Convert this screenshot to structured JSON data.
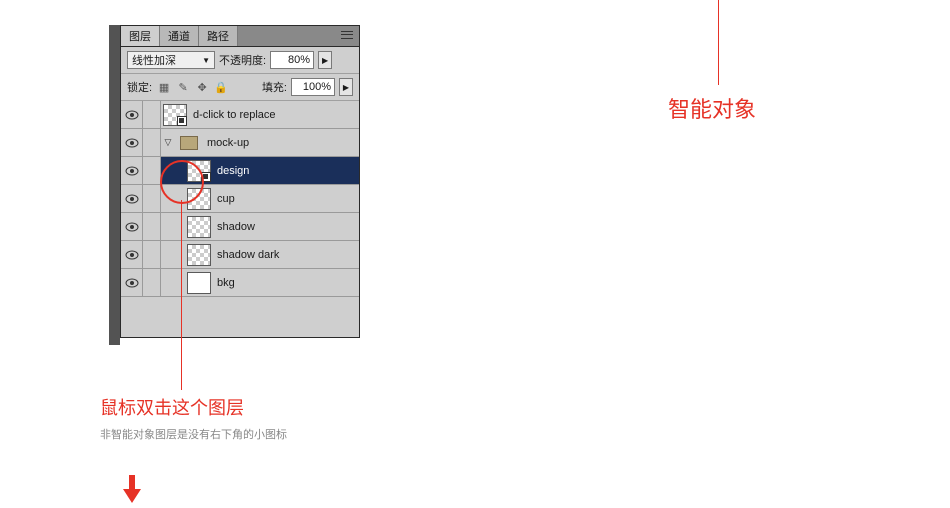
{
  "colors": {
    "accent": "#e63226"
  },
  "tabs": {
    "layers": "图层",
    "channels": "通道",
    "paths": "路径"
  },
  "blend": {
    "mode": "线性加深",
    "opacity_label": "不透明度:",
    "opacity": "80%"
  },
  "lock": {
    "label": "锁定:",
    "fill_label": "填充:",
    "fill": "100%"
  },
  "layers": [
    {
      "name": "d-click to replace",
      "type": "smart"
    },
    {
      "name": "mock-up",
      "type": "folder"
    },
    {
      "name": "design",
      "type": "smart",
      "selected": true
    },
    {
      "name": "cup",
      "type": "checker"
    },
    {
      "name": "shadow",
      "type": "checker"
    },
    {
      "name": "shadow dark",
      "type": "checker"
    },
    {
      "name": "bkg",
      "type": "plain"
    }
  ],
  "anno": {
    "left_title": "鼠标双击这个图层",
    "left_sub": "非智能对象图层是没有右下角的小图标",
    "right": "智能对象"
  }
}
